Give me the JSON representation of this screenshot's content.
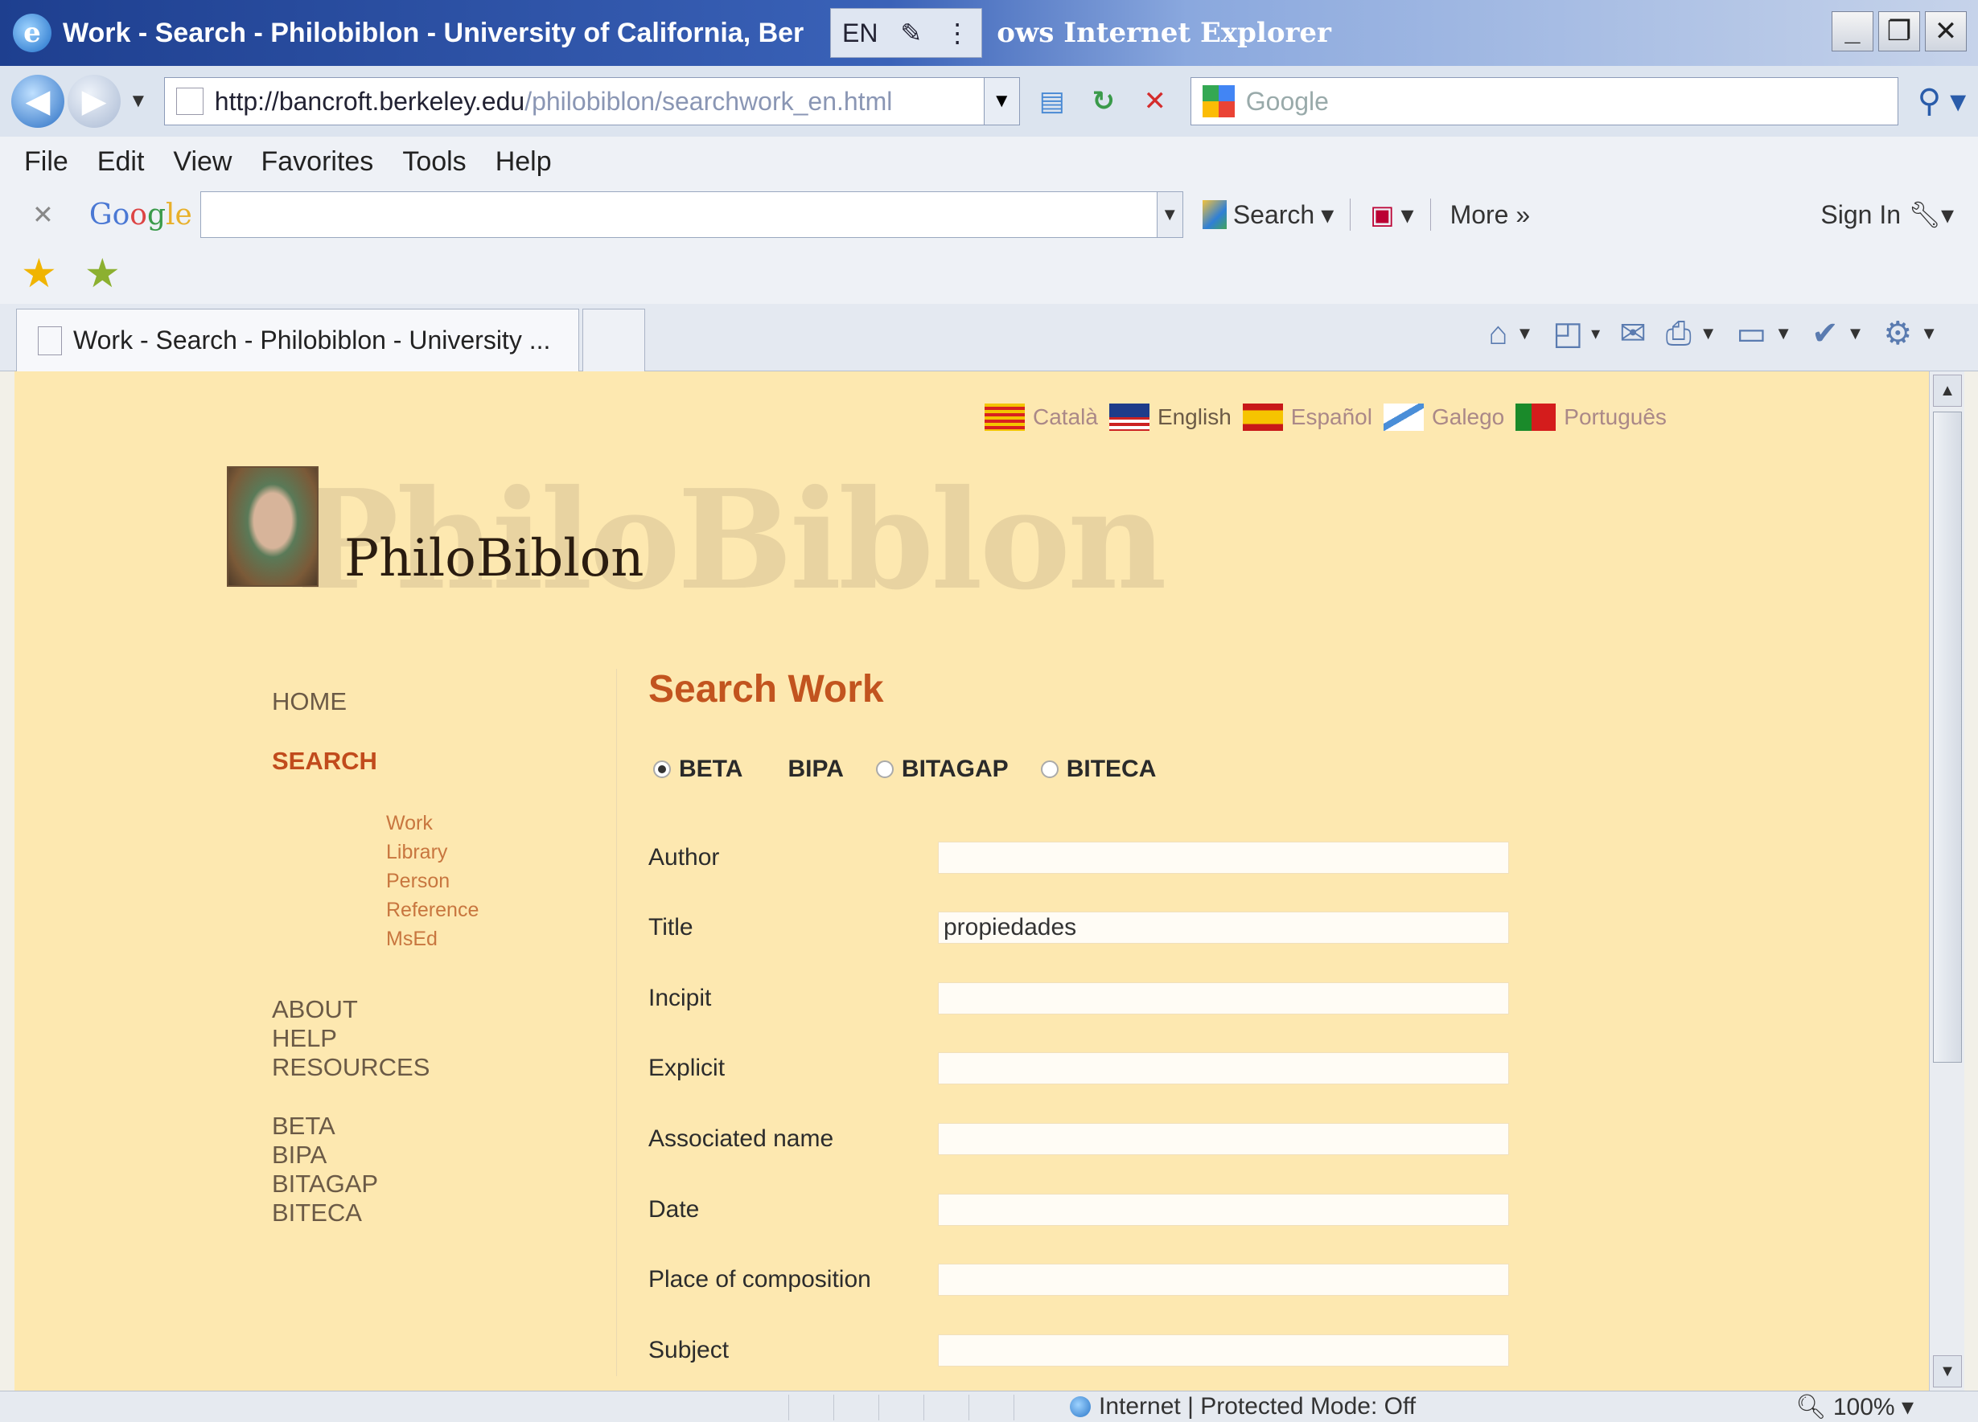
{
  "window": {
    "title": "Work - Search - Philobiblon - University of California, Ber",
    "ime": [
      "EN"
    ],
    "title_tail": "ows Internet Explorer",
    "controls": [
      "_",
      "❐",
      "✕"
    ]
  },
  "address": {
    "url_host": "http://bancroft.berkeley.edu",
    "url_path": "/philobiblon/searchwork_en.html",
    "search_placeholder": "Google"
  },
  "menu": [
    "File",
    "Edit",
    "View",
    "Favorites",
    "Tools",
    "Help"
  ],
  "google_toolbar": {
    "logo": [
      "Go",
      "o",
      "g",
      "le"
    ],
    "search_label": "Search",
    "more_label": "More »",
    "signin_label": "Sign In"
  },
  "tab": {
    "label": "Work - Search - Philobiblon - University ..."
  },
  "languages": [
    "Català",
    "English",
    "Español",
    "Galego",
    "Português"
  ],
  "site": {
    "logo_text": "PhiloBiblon",
    "watermark": "PhiloBiblon"
  },
  "sidebar": {
    "home": "HOME",
    "search": "SEARCH",
    "sub": [
      "Work",
      "Library",
      "Person",
      "Reference",
      "MsEd"
    ],
    "about": "ABOUT",
    "help": "HELP",
    "resources": "RESOURCES",
    "dbs": [
      "BETA",
      "BIPA",
      "BITAGAP",
      "BITECA"
    ]
  },
  "main": {
    "heading": "Search Work",
    "databases": [
      {
        "label": "BETA",
        "selected": true
      },
      {
        "label": "BIPA",
        "selected": false
      },
      {
        "label": "BITAGAP",
        "selected": false
      },
      {
        "label": "BITECA",
        "selected": false
      }
    ],
    "fields": [
      {
        "label": "Author",
        "value": ""
      },
      {
        "label": "Title",
        "value": "propiedades"
      },
      {
        "label": "Incipit",
        "value": ""
      },
      {
        "label": "Explicit",
        "value": ""
      },
      {
        "label": "Associated name",
        "value": ""
      },
      {
        "label": "Date",
        "value": ""
      },
      {
        "label": "Place of composition",
        "value": ""
      },
      {
        "label": "Subject",
        "value": ""
      }
    ]
  },
  "status": {
    "zone": "Internet | Protected Mode: Off",
    "zoom": "100%"
  },
  "colors": {
    "page_bg": "#fde8b0",
    "heading": "#c2541f",
    "nav_selected": "#c14b1c",
    "nav_sub": "#c8763f"
  }
}
